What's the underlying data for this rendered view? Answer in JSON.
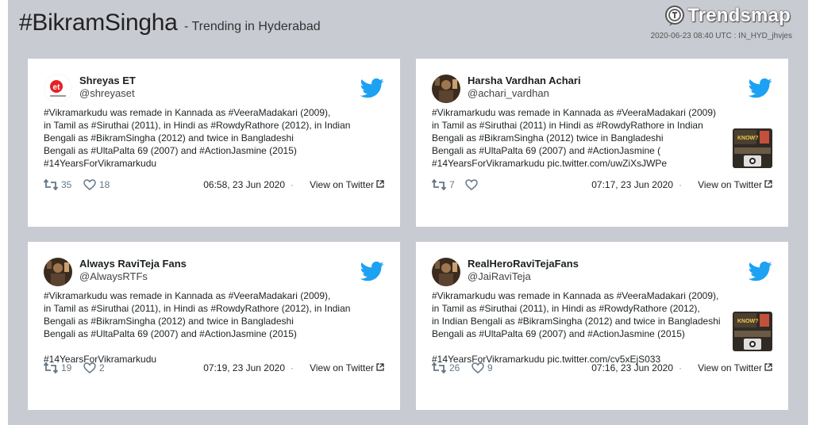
{
  "header": {
    "hashtag": "#BikramSingha",
    "subtitle": "- Trending in Hyderabad",
    "logo_text": "Trendsmap",
    "meta": "2020-06-23 08:40 UTC : IN_HYD_jhvjes"
  },
  "colors": {
    "background": "#c9cbd2",
    "twitter_blue": "#1da1f2",
    "card": "#ffffff"
  },
  "tweets": [
    {
      "name": "Shreyas ET",
      "handle": "@shreyaset",
      "lines": [
        "#Vikramarkudu was remade in Kannada as #VeeraMadakari (2009),",
        "in Tamil as #Siruthai (2011), in Hindi as #RowdyRathore (2012), in Indian",
        "Bengali as #BikramSingha (2012) and twice in Bangladeshi",
        "Bengali as #UltaPalta 69 (2007) and #ActionJasmine (2015)",
        "#14YearsForVikramarkudu"
      ],
      "retweets": "35",
      "likes": "18",
      "time": "06:58, 23 Jun 2020",
      "view": "View on Twitter",
      "avatar_icon": "et-logo-avatar",
      "has_media": false
    },
    {
      "name": "Harsha Vardhan Achari",
      "handle": "@achari_vardhan",
      "lines": [
        "#Vikramarkudu was remade in Kannada as #VeeraMadakari (2009)",
        "in Tamil as #Siruthai (2011) in Hindi as #RowdyRathore  in Indian",
        "Bengali as #BikramSingha (2012) twice in Bangladeshi",
        "Bengali as #UltaPalta 69 (2007) and #ActionJasmine (",
        "#14YearsForVikramarkudu pic.twitter.com/uwZiXsJWPe"
      ],
      "retweets": "7",
      "likes": "",
      "time": "07:17, 23 Jun 2020",
      "view": "View on Twitter",
      "avatar_icon": "photo-avatar",
      "has_media": true
    },
    {
      "name": "Always RaviTeja Fans",
      "handle": "@AlwaysRTFs",
      "lines": [
        "#Vikramarkudu was remade in Kannada as #VeeraMadakari (2009),",
        "in Tamil as #Siruthai (2011), in Hindi as #RowdyRathore (2012), in Indian",
        "Bengali as #BikramSingha (2012) and twice in Bangladeshi",
        "Bengali as #UltaPalta 69 (2007) and #ActionJasmine (2015)",
        "",
        "#14YearsForVikramarkudu"
      ],
      "retweets": "19",
      "likes": "2",
      "time": "07:19, 23 Jun 2020",
      "view": "View on Twitter",
      "avatar_icon": "photo-avatar",
      "has_media": false
    },
    {
      "name": "RealHeroRaviTejaFans",
      "handle": "@JaiRaviTeja",
      "lines": [
        "#Vikramarkudu was remade in Kannada as #VeeraMadakari (2009),",
        "in Tamil as #Siruthai (2011), in Hindi as #RowdyRathore (2012),",
        "in Indian Bengali as #BikramSingha (2012) and twice in Bangladeshi",
        "Bengali as #UltaPalta 69 (2007) and #ActionJasmine (2015)",
        "",
        "#14YearsForVikramarkudu pic.twitter.com/cv5xEjS033"
      ],
      "retweets": "26",
      "likes": "9",
      "time": "07:16, 23 Jun 2020",
      "view": "View on Twitter",
      "avatar_icon": "photo-avatar",
      "has_media": true
    }
  ]
}
